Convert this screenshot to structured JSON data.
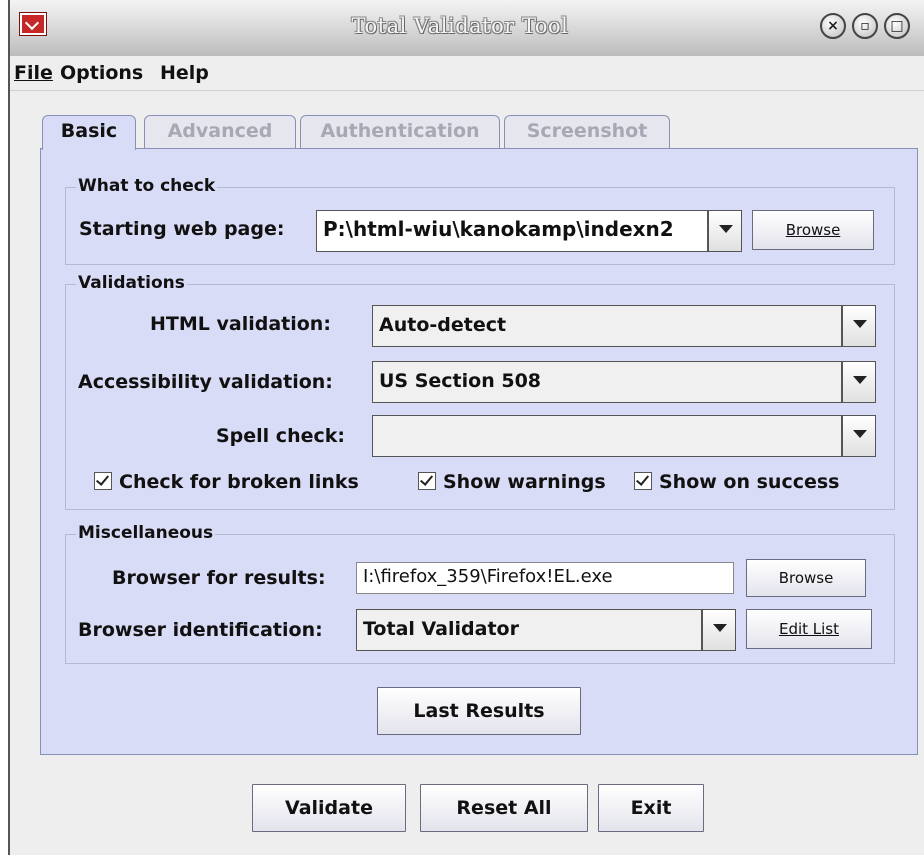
{
  "window": {
    "title": "Total Validator Tool",
    "controls": {
      "close": "×",
      "minimize": "▫",
      "maximize": "□"
    }
  },
  "menu": [
    "File",
    "Options",
    "Help"
  ],
  "tabs": [
    "Basic",
    "Advanced",
    "Authentication",
    "Screenshot"
  ],
  "what_to_check": {
    "group_title": "What to check",
    "start_label": "Starting web page:",
    "start_value": "P:\\html-wiu\\kanokamp\\indexn2",
    "browse_label": "Browse"
  },
  "validations": {
    "group_title": "Validations",
    "html_label": "HTML validation:",
    "html_value": "Auto-detect",
    "access_label": "Accessibility validation:",
    "access_value": "US Section 508",
    "spell_label": "Spell check:",
    "spell_value": "",
    "check_broken": "Check for broken links",
    "show_warnings": "Show warnings",
    "show_success": "Show on success"
  },
  "misc": {
    "group_title": "Miscellaneous",
    "browser_label": "Browser for results:",
    "browser_value": "I:\\firefox_359\\Firefox!EL.exe",
    "browse_label": "Browse",
    "ident_label": "Browser identification:",
    "ident_value": "Total Validator",
    "edit_list_label": "Edit List"
  },
  "last_results_label": "Last Results",
  "bottom_buttons": [
    "Validate",
    "Reset All",
    "Exit"
  ]
}
